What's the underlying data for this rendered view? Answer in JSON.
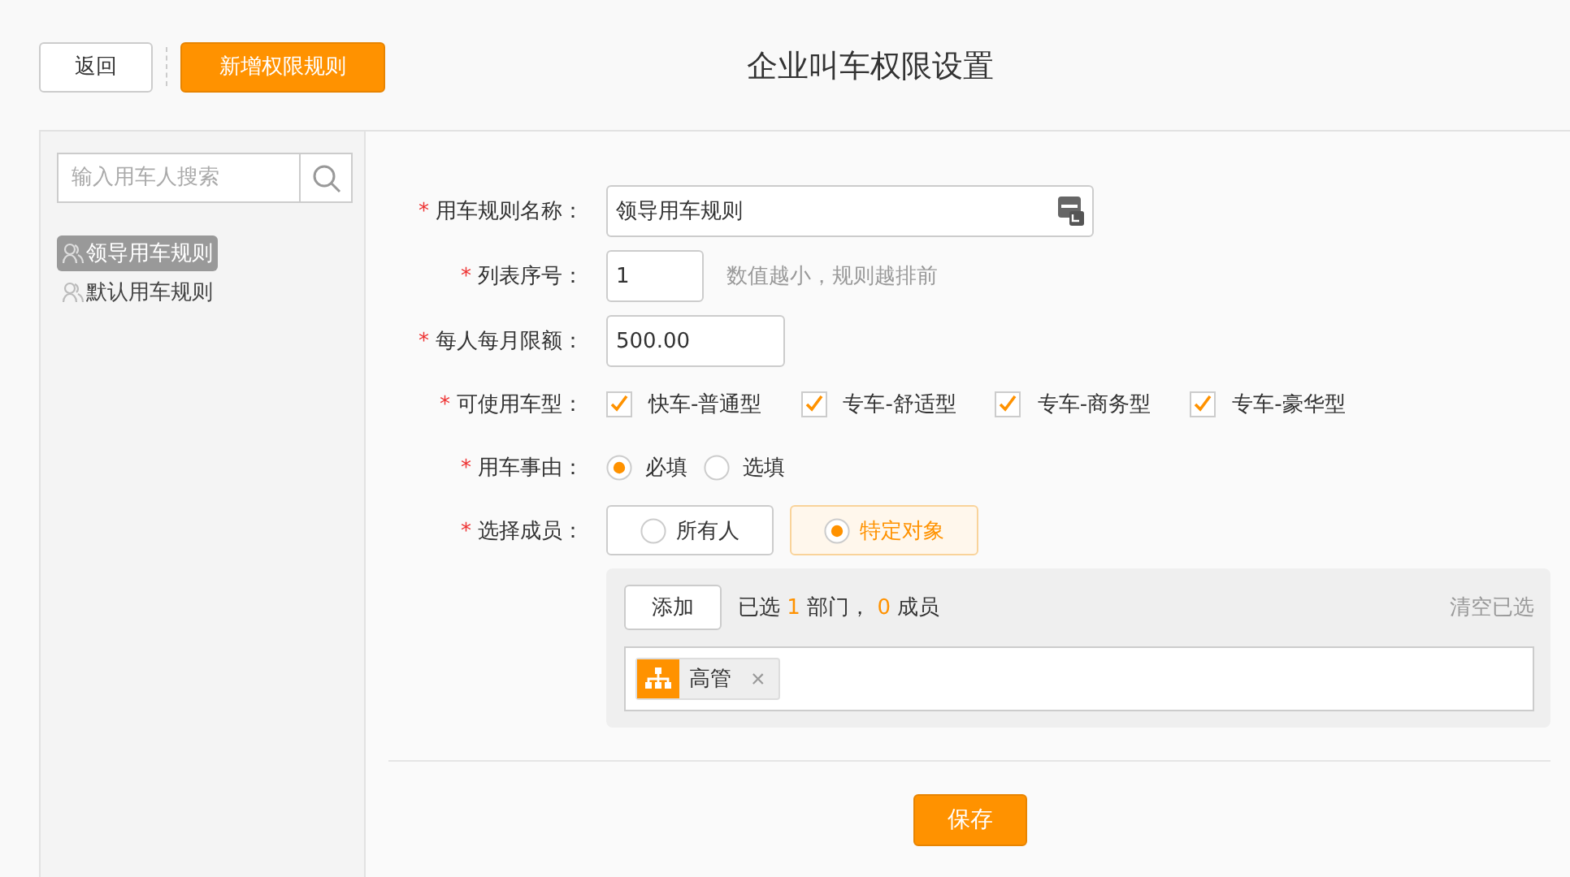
{
  "header": {
    "back": "返回",
    "add_rule": "新增权限规则",
    "title": "企业叫车权限设置"
  },
  "sidebar": {
    "search": {
      "placeholder": "输入用车人搜索"
    },
    "items": [
      {
        "label": "领导用车规则",
        "selected": true
      },
      {
        "label": "默认用车规则",
        "selected": false
      }
    ]
  },
  "form": {
    "name": {
      "label": "用车规则名称：",
      "value": "领导用车规则"
    },
    "order": {
      "label": "列表序号：",
      "value": "1",
      "hint": "数值越小，规则越排前"
    },
    "limit": {
      "label": "每人每月限额：",
      "value": "500.00"
    },
    "car_types": {
      "label": "可使用车型：",
      "options": [
        {
          "label": "快车-普通型",
          "checked": true
        },
        {
          "label": "专车-舒适型",
          "checked": true
        },
        {
          "label": "专车-商务型",
          "checked": true
        },
        {
          "label": "专车-豪华型",
          "checked": true
        }
      ]
    },
    "reason": {
      "label": "用车事由：",
      "options": [
        {
          "label": "必填",
          "selected": true
        },
        {
          "label": "选填",
          "selected": false
        }
      ]
    },
    "members": {
      "label": "选择成员：",
      "options": [
        {
          "label": "所有人",
          "selected": false
        },
        {
          "label": "特定对象",
          "selected": true
        }
      ]
    },
    "selection": {
      "add": "添加",
      "summary": {
        "prefix": "已选",
        "departments": "1",
        "department_label": "部门，",
        "members": "0",
        "member_label": "成员"
      },
      "clear": "清空已选",
      "tags": [
        {
          "label": "高管",
          "remove": "×"
        }
      ]
    },
    "required_mark": "*",
    "save": "保存"
  }
}
